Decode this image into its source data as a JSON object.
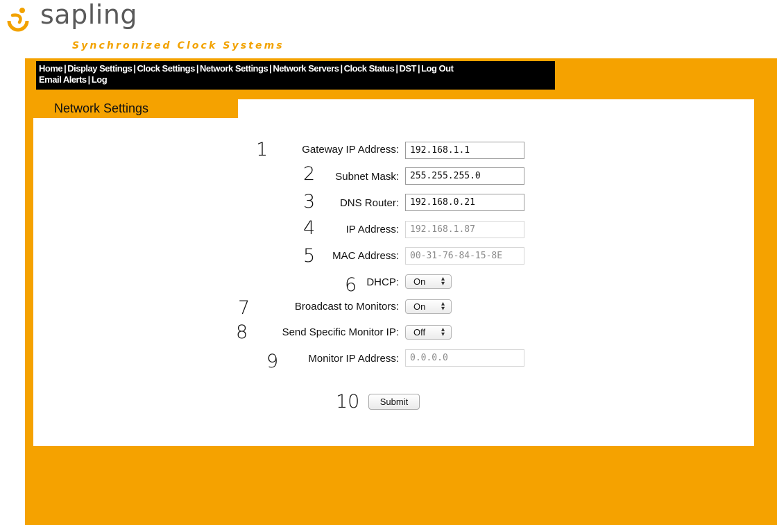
{
  "brand": {
    "name": "sapling",
    "tagline": "Synchronized Clock Systems",
    "icon": "sapling-logo-icon",
    "accent_color": "#f5a200"
  },
  "nav": {
    "line1": [
      "Home",
      "Display Settings",
      "Clock Settings",
      "Network Settings",
      "Network Servers",
      "Clock Status",
      "DST",
      "Log Out"
    ],
    "line2": [
      "Email Alerts",
      "Log"
    ],
    "separator": "|"
  },
  "page": {
    "title": "Network Settings"
  },
  "form": {
    "gateway": {
      "number": "1",
      "label": "Gateway IP Address:",
      "value": "192.168.1.1"
    },
    "subnet": {
      "number": "2",
      "label": "Subnet Mask:",
      "value": "255.255.255.0"
    },
    "dns": {
      "number": "3",
      "label": "DNS Router:",
      "value": "192.168.0.21"
    },
    "ip": {
      "number": "4",
      "label": "IP Address:",
      "value": "192.168.1.87"
    },
    "mac": {
      "number": "5",
      "label": "MAC Address:",
      "value": "00-31-76-84-15-8E"
    },
    "dhcp": {
      "number": "6",
      "label": "DHCP:",
      "value": "On"
    },
    "broadcast": {
      "number": "7",
      "label": "Broadcast to Monitors:",
      "value": "On"
    },
    "specific": {
      "number": "8",
      "label": "Send Specific Monitor IP:",
      "value": "Off"
    },
    "monitor_ip": {
      "number": "9",
      "label": "Monitor IP Address:",
      "value": "0.0.0.0"
    },
    "submit": {
      "number": "10",
      "label": "Submit"
    }
  }
}
